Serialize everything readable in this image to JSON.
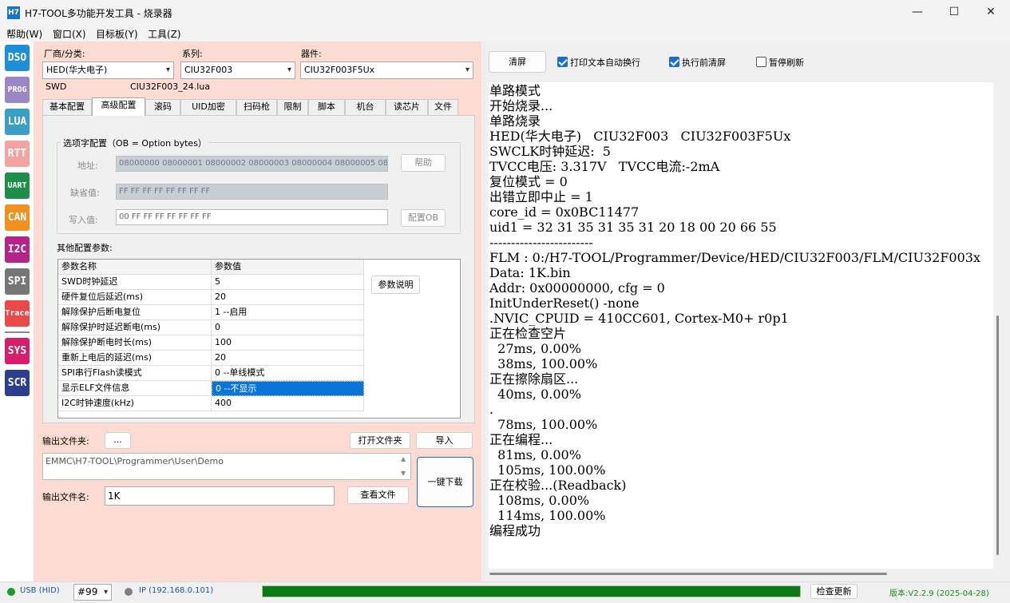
{
  "window": {
    "title": "H7-TOOL多功能开发工具 - 烧录器",
    "logo": "H7",
    "controls": {
      "minimize": "—",
      "maximize": "☐",
      "close": "✕"
    }
  },
  "menu": [
    "帮助(W)",
    "窗口(X)",
    "目标板(Y)",
    "工具(Z)"
  ],
  "tools": [
    {
      "label": "DSO",
      "color": "#1e8fd6"
    },
    {
      "label": "PROG",
      "color": "#9b86c6"
    },
    {
      "label": "LUA",
      "color": "#3a9fc4"
    },
    {
      "label": "RTT",
      "color": "#f4a3a3"
    },
    {
      "label": "UART",
      "color": "#1e8f4a"
    },
    {
      "label": "CAN",
      "color": "#f0901f"
    },
    {
      "label": "I2C",
      "color": "#b3248a"
    },
    {
      "label": "SPI",
      "color": "#767676"
    },
    {
      "label": "Trace",
      "color": "#e84a4a"
    },
    {
      "label": "SYS",
      "color": "#d61f6b"
    },
    {
      "label": "SCR",
      "color": "#2f3f8f"
    }
  ],
  "selectors": {
    "vendor_label": "厂商/分类:",
    "vendor": "HED(华大电子)",
    "series_label": "系列:",
    "series": "CIU32F003",
    "device_label": "器件:",
    "device": "CIU32F003F5Ux",
    "interface": "SWD",
    "lua_file": "CIU32F003_24.lua"
  },
  "tabs": [
    "基本配置",
    "高级配置",
    "滚码",
    "UID加密",
    "扫码枪",
    "限制",
    "脚本",
    "机台",
    "读芯片",
    "文件"
  ],
  "option_bytes": {
    "group_title": "选项字配置（OB = Option bytes）",
    "address_label": "地址:",
    "address": "08000000 08000001 08000002 08000003 08000004 08000005 08000",
    "default_label": "缺省值:",
    "default": "FF FF FF FF FF FF FF FF",
    "write_label": "写入值:",
    "write": "00 FF FF FF FF FF FF FF",
    "help_btn": "帮助",
    "config_btn": "配置OB"
  },
  "params": {
    "title": "其他配置参数:",
    "headers": [
      "参数名称",
      "参数值"
    ],
    "rows": [
      [
        "SWD时钟延迟",
        "5"
      ],
      [
        "硬件复位后延迟(ms)",
        "20"
      ],
      [
        "解除保护后断电复位",
        "1 --启用"
      ],
      [
        "解除保护时延迟断电(ms)",
        "0"
      ],
      [
        "解除保护断电时长(ms)",
        "100"
      ],
      [
        "重新上电后的延迟(ms)",
        "20"
      ],
      [
        "SPI串行Flash读模式",
        "0 --单线模式"
      ],
      [
        "显示ELF文件信息",
        "0 --不显示"
      ],
      [
        "I2C时钟速度(kHz)",
        "400"
      ]
    ],
    "explain_btn": "参数说明"
  },
  "output": {
    "folder_label": "输出文件夹:",
    "browse_btn": "...",
    "open_btn": "打开文件夹",
    "import_btn": "导入",
    "path": "EMMC\\H7-TOOL\\Programmer\\User\\Demo",
    "name_label": "输出文件名:",
    "name": "1K",
    "view_btn": "查看文件",
    "download_btn": "一键下载"
  },
  "console_toolbar": {
    "clear_btn": "清屏",
    "opt_wrap": "打印文本自动换行",
    "opt_clear_before": "执行前清屏",
    "opt_pause": "暂停刷新"
  },
  "console": [
    "单路模式",
    "开始烧录...",
    "单路烧录",
    "HED(华大电子)   CIU32F003   CIU32F003F5Ux",
    "SWCLK时钟延迟:  5",
    "TVCC电压: 3.317V   TVCC电流:-2mA",
    "复位模式 = 0",
    "出错立即中止 = 1",
    "core_id = 0x0BC11477",
    "uid1 = 32 31 35 31 35 31 20 18 00 20 66 55",
    "------------------------",
    "FLM : 0:/H7-TOOL/Programmer/Device/HED/CIU32F003/FLM/CIU32F003x",
    "Data: 1K.bin",
    "Addr: 0x00000000, cfg = 0",
    "InitUnderReset() -none",
    ".NVIC_CPUID = 410CC601, Cortex-M0+ r0p1",
    "正在检查空片",
    "  27ms, 0.00%",
    "  38ms, 100.00%",
    "正在擦除扇区...",
    "  40ms, 0.00%",
    ".",
    "  78ms, 100.00%",
    "正在编程...",
    "  81ms, 0.00%",
    "  105ms, 100.00%",
    "正在校验...(Readback)",
    "  108ms, 0.00%",
    "  114ms, 100.00%",
    "编程成功"
  ],
  "status": {
    "usb": "USB (HID)",
    "port": "#99",
    "ip": "IP (192.168.0.101)",
    "progress": 1.0,
    "progress_color": "#0a7a14",
    "update_btn": "检查更新",
    "version": "版本:V2.2.9 (2025-04-28)",
    "version_color": "#1a8a1a"
  }
}
